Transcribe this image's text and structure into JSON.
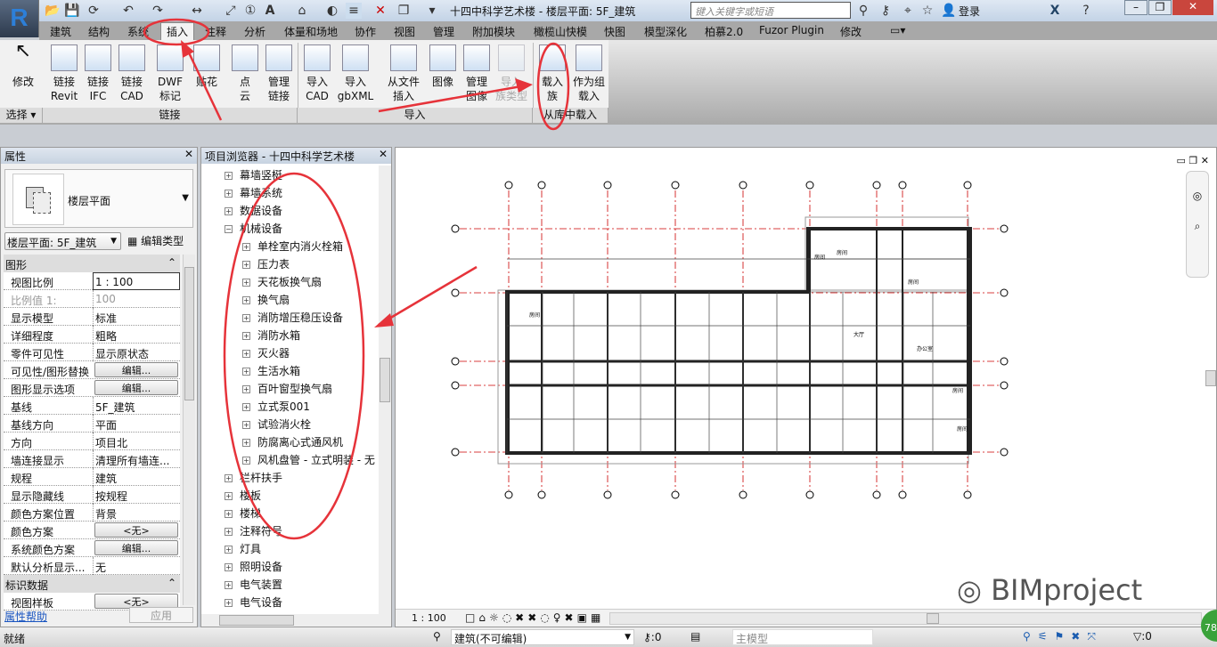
{
  "title": "十四中科学艺术楼 - 楼层平面: 5F_建筑",
  "search_placeholder": "键入关键字或短语",
  "login": "登录",
  "tabs": [
    "建筑",
    "结构",
    "系统",
    "插入",
    "注释",
    "分析",
    "体量和场地",
    "协作",
    "视图",
    "管理",
    "附加模块",
    "橄榄山快模",
    "快图",
    "模型深化",
    "柏慕2.0",
    "Fuzor Plugin",
    "修改"
  ],
  "active_tab": "插入",
  "ribbon": {
    "buttons": [
      {
        "l1": "修改",
        "l2": ""
      },
      {
        "l1": "链接",
        "l2": "Revit"
      },
      {
        "l1": "链接",
        "l2": "IFC"
      },
      {
        "l1": "链接",
        "l2": "CAD"
      },
      {
        "l1": "DWF",
        "l2": "标记"
      },
      {
        "l1": "贴花",
        "l2": ""
      },
      {
        "l1": "点",
        "l2": "云"
      },
      {
        "l1": "管理",
        "l2": "链接"
      },
      {
        "l1": "导入",
        "l2": "CAD"
      },
      {
        "l1": "导入",
        "l2": "gbXML"
      },
      {
        "l1": "从文件",
        "l2": "插入"
      },
      {
        "l1": "图像",
        "l2": ""
      },
      {
        "l1": "管理",
        "l2": "图像"
      },
      {
        "l1": "导入",
        "l2": "族类型"
      },
      {
        "l1": "载入",
        "l2": "族"
      },
      {
        "l1": "作为组",
        "l2": "载入"
      }
    ],
    "panels": [
      "选择",
      "链接",
      "导入",
      "从库中载入"
    ]
  },
  "properties": {
    "title": "属性",
    "type_name": "楼层平面",
    "selector": "楼层平面: 5F_建筑",
    "edit_type": "编辑类型",
    "group1": "图形",
    "rows": [
      {
        "k": "视图比例",
        "v": "1 : 100"
      },
      {
        "k": "比例值 1:",
        "v": "100"
      },
      {
        "k": "显示模型",
        "v": "标准"
      },
      {
        "k": "详细程度",
        "v": "粗略"
      },
      {
        "k": "零件可见性",
        "v": "显示原状态"
      },
      {
        "k": "可见性/图形替换",
        "v": "编辑..."
      },
      {
        "k": "图形显示选项",
        "v": "编辑..."
      },
      {
        "k": "基线",
        "v": "5F_建筑"
      },
      {
        "k": "基线方向",
        "v": "平面"
      },
      {
        "k": "方向",
        "v": "项目北"
      },
      {
        "k": "墙连接显示",
        "v": "清理所有墙连..."
      },
      {
        "k": "规程",
        "v": "建筑"
      },
      {
        "k": "显示隐藏线",
        "v": "按规程"
      },
      {
        "k": "颜色方案位置",
        "v": "背景"
      },
      {
        "k": "颜色方案",
        "v": "<无>"
      },
      {
        "k": "系统颜色方案",
        "v": "编辑..."
      },
      {
        "k": "默认分析显示...",
        "v": "无"
      }
    ],
    "group2": "标识数据",
    "row_last": {
      "k": "视图样板",
      "v": "<无>"
    },
    "help": "属性帮助",
    "apply": "应用"
  },
  "browser": {
    "title": "项目浏览器 - 十四中科学艺术楼",
    "items": [
      {
        "t": "幕墙竖梃",
        "lv": 1
      },
      {
        "t": "幕墙系统",
        "lv": 1
      },
      {
        "t": "数据设备",
        "lv": 1
      },
      {
        "t": "机械设备",
        "lv": 1,
        "open": true
      },
      {
        "t": "单栓室内消火栓箱",
        "lv": 2
      },
      {
        "t": "压力表",
        "lv": 2
      },
      {
        "t": "天花板换气扇",
        "lv": 2
      },
      {
        "t": "换气扇",
        "lv": 2
      },
      {
        "t": "消防增压稳压设备",
        "lv": 2
      },
      {
        "t": "消防水箱",
        "lv": 2
      },
      {
        "t": "灭火器",
        "lv": 2
      },
      {
        "t": "生活水箱",
        "lv": 2
      },
      {
        "t": "百叶窗型换气扇",
        "lv": 2
      },
      {
        "t": "立式泵001",
        "lv": 2
      },
      {
        "t": "试验消火栓",
        "lv": 2
      },
      {
        "t": "防腐离心式通风机",
        "lv": 2
      },
      {
        "t": "风机盘管 - 立式明装 - 无",
        "lv": 2
      },
      {
        "t": "栏杆扶手",
        "lv": 1
      },
      {
        "t": "楼板",
        "lv": 1
      },
      {
        "t": "楼梯",
        "lv": 1
      },
      {
        "t": "注释符号",
        "lv": 1
      },
      {
        "t": "灯具",
        "lv": 1
      },
      {
        "t": "照明设备",
        "lv": 1
      },
      {
        "t": "电气装置",
        "lv": 1
      },
      {
        "t": "电气设备",
        "lv": 1
      }
    ]
  },
  "view": {
    "scale": "1 : 100",
    "rooms": [
      "房间",
      "房间",
      "大厅",
      "办公室",
      "房间",
      "房间",
      "房间",
      "房间"
    ],
    "watermark": "BIMproject"
  },
  "status": {
    "ready": "就绪",
    "workset": "建筑(不可编辑)",
    "count1": ":0",
    "model": "主模型",
    "filter": ":0",
    "badge": "78"
  }
}
